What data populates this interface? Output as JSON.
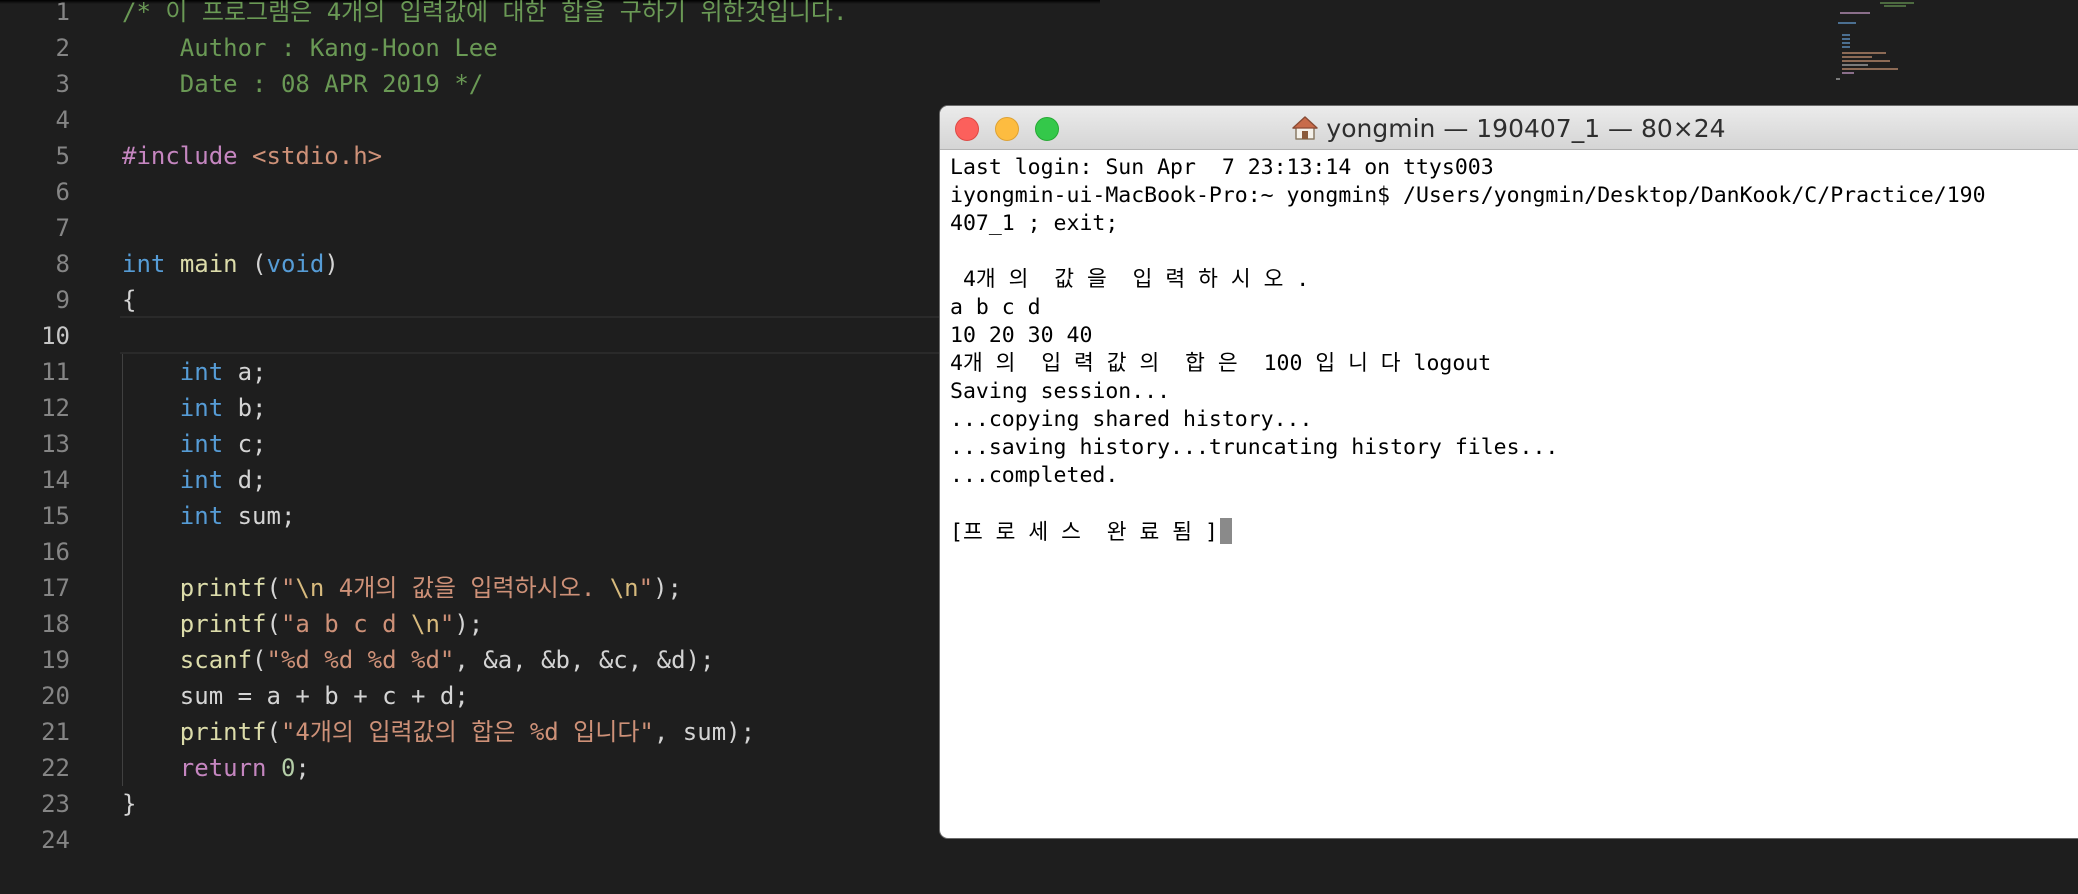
{
  "editor": {
    "line_numbers": [
      "1",
      "2",
      "3",
      "4",
      "5",
      "6",
      "7",
      "8",
      "9",
      "10",
      "11",
      "12",
      "13",
      "14",
      "15",
      "16",
      "17",
      "18",
      "19",
      "20",
      "21",
      "22",
      "23",
      "24"
    ],
    "lines": [
      [
        {
          "t": "/* 이 프로그램은 4개의 입력값에 대한 합을 구하기 위한것입니다.",
          "c": "comment"
        }
      ],
      [
        {
          "t": "    Author : Kang-Hoon Lee",
          "c": "comment"
        }
      ],
      [
        {
          "t": "    Date : 08 APR 2019 */",
          "c": "comment"
        }
      ],
      [],
      [
        {
          "t": "#include",
          "c": "ctl"
        },
        {
          "t": " "
        },
        {
          "t": "<stdio.h>",
          "c": "str"
        }
      ],
      [],
      [],
      [
        {
          "t": "int",
          "c": "kw"
        },
        {
          "t": " "
        },
        {
          "t": "main",
          "c": "fn"
        },
        {
          "t": " ("
        },
        {
          "t": "void",
          "c": "kw"
        },
        {
          "t": ")"
        }
      ],
      [
        {
          "t": "{"
        }
      ],
      [],
      [
        {
          "t": "    "
        },
        {
          "t": "int",
          "c": "kw"
        },
        {
          "t": " a;"
        }
      ],
      [
        {
          "t": "    "
        },
        {
          "t": "int",
          "c": "kw"
        },
        {
          "t": " b;"
        }
      ],
      [
        {
          "t": "    "
        },
        {
          "t": "int",
          "c": "kw"
        },
        {
          "t": " c;"
        }
      ],
      [
        {
          "t": "    "
        },
        {
          "t": "int",
          "c": "kw"
        },
        {
          "t": " d;"
        }
      ],
      [
        {
          "t": "    "
        },
        {
          "t": "int",
          "c": "kw"
        },
        {
          "t": " sum;"
        }
      ],
      [],
      [
        {
          "t": "    "
        },
        {
          "t": "printf",
          "c": "fn"
        },
        {
          "t": "("
        },
        {
          "t": "\"",
          "c": "str"
        },
        {
          "t": "\\n",
          "c": "esc"
        },
        {
          "t": " 4개의 값을 입력하시오. ",
          "c": "str"
        },
        {
          "t": "\\n",
          "c": "esc"
        },
        {
          "t": "\"",
          "c": "str"
        },
        {
          "t": ");"
        }
      ],
      [
        {
          "t": "    "
        },
        {
          "t": "printf",
          "c": "fn"
        },
        {
          "t": "("
        },
        {
          "t": "\"a b c d ",
          "c": "str"
        },
        {
          "t": "\\n",
          "c": "esc"
        },
        {
          "t": "\"",
          "c": "str"
        },
        {
          "t": ");"
        }
      ],
      [
        {
          "t": "    "
        },
        {
          "t": "scanf",
          "c": "fn"
        },
        {
          "t": "("
        },
        {
          "t": "\"%d %d %d %d\"",
          "c": "str"
        },
        {
          "t": ", &a, &b, &c, &d);"
        }
      ],
      [
        {
          "t": "    sum = a + b + c + d;"
        }
      ],
      [
        {
          "t": "    "
        },
        {
          "t": "printf",
          "c": "fn"
        },
        {
          "t": "("
        },
        {
          "t": "\"4개의 입력값의 합은 %d 입니다\"",
          "c": "str"
        },
        {
          "t": ", sum);"
        }
      ],
      [
        {
          "t": "    "
        },
        {
          "t": "return",
          "c": "ctl"
        },
        {
          "t": " "
        },
        {
          "t": "0",
          "c": "num"
        },
        {
          "t": ";"
        }
      ],
      [
        {
          "t": "}"
        }
      ],
      []
    ],
    "active_line": "10"
  },
  "terminal": {
    "title": "yongmin — 190407_1 — 80×24",
    "icon": "home-icon",
    "lines": [
      "Last login: Sun Apr  7 23:13:14 on ttys003",
      "iyongmin-ui-MacBook-Pro:~ yongmin$ /Users/yongmin/Desktop/DanKook/C/Practice/190",
      "407_1 ; exit;",
      "",
      " 4개 의  값 을  입 력 하 시 오 .",
      "a b c d",
      "10 20 30 40",
      "4개 의  입 력 값 의  합 은  100 입 니 다 logout",
      "Saving session...",
      "...copying shared history...",
      "...saving history...truncating history files...",
      "...completed.",
      "",
      "[프 로 세 스  완 료 됨 ]"
    ]
  },
  "colors": {
    "editor_bg": "#1e1e1e",
    "comment": "#6a9955",
    "keyword": "#569cd6",
    "function": "#dcdcaa",
    "string": "#ce9178",
    "terminal_bg": "#ffffff"
  }
}
